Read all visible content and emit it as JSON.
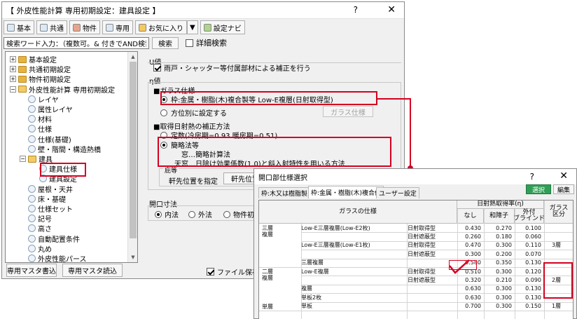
{
  "window": {
    "title": "【 外皮性能計算 専用初期設定：建具設定 】",
    "help": "?",
    "close": "✕"
  },
  "toolbar": [
    {
      "label": "基本",
      "icon": "gear-icon"
    },
    {
      "label": "共通",
      "icon": "gear-icon"
    },
    {
      "label": "物件",
      "icon": "house-icon"
    },
    {
      "label": "専用",
      "icon": "gear-icon"
    },
    {
      "label": "お気に入り",
      "icon": "star-folder-icon"
    },
    {
      "label": "▼",
      "icon": ""
    },
    {
      "label": "設定ナビ",
      "icon": "navi-icon"
    }
  ],
  "search": {
    "value": "検索ワード入力：（複数可。& 付きでAND検索文字）",
    "button": "検索",
    "detail_label": "詳細検索"
  },
  "tree": [
    {
      "label": "基本設定",
      "level": 0,
      "expander": "+",
      "icon": "folder"
    },
    {
      "label": "共通初期設定",
      "level": 0,
      "expander": "+",
      "icon": "folder"
    },
    {
      "label": "物件初期設定",
      "level": 0,
      "expander": "+",
      "icon": "folder"
    },
    {
      "label": "外皮性能計算 専用初期設定",
      "level": 0,
      "expander": "−",
      "icon": "folder-open"
    },
    {
      "label": "レイヤ",
      "level": 1,
      "expander": "",
      "icon": "page"
    },
    {
      "label": "属性レイヤ",
      "level": 1,
      "expander": "",
      "icon": "page"
    },
    {
      "label": "材料",
      "level": 1,
      "expander": "",
      "icon": "page"
    },
    {
      "label": "仕様",
      "level": 1,
      "expander": "",
      "icon": "page"
    },
    {
      "label": "仕様(基礎)",
      "level": 1,
      "expander": "",
      "icon": "page"
    },
    {
      "label": "壁・階間・構造熱橋",
      "level": 1,
      "expander": "",
      "icon": "page"
    },
    {
      "label": "建具",
      "level": 1,
      "expander": "−",
      "icon": "folder-open"
    },
    {
      "label": "建具仕様",
      "level": 2,
      "expander": "",
      "icon": "page"
    },
    {
      "label": "建具設定",
      "level": 2,
      "expander": "",
      "icon": "page"
    },
    {
      "label": "屋根・天井",
      "level": 1,
      "expander": "",
      "icon": "page"
    },
    {
      "label": "床・基礎",
      "level": 1,
      "expander": "",
      "icon": "page"
    },
    {
      "label": "仕様セット",
      "level": 1,
      "expander": "",
      "icon": "page"
    },
    {
      "label": "記号",
      "level": 1,
      "expander": "",
      "icon": "page"
    },
    {
      "label": "高さ",
      "level": 1,
      "expander": "",
      "icon": "page"
    },
    {
      "label": "自動配置条件",
      "level": 1,
      "expander": "",
      "icon": "page"
    },
    {
      "label": "丸め",
      "level": 1,
      "expander": "",
      "icon": "page"
    },
    {
      "label": "外皮性能パース",
      "level": 1,
      "expander": "",
      "icon": "page"
    }
  ],
  "bottom": {
    "write_btn": "専用マスタ書込",
    "read_btn": "専用マスタ読込",
    "save_file": "ファイル保存"
  },
  "panel": {
    "u_title": "U値",
    "u_check": "雨戸・シャッター等付属部材による補正を行う",
    "eta_title": "η値",
    "glass_title": "■ガラス仕様",
    "glass_opt1": "枠:金属・樹脂(木)複合製等 Low-E複層(日射取得型)",
    "glass_opt2": "方位別に設定する",
    "glass_btn": "ガラス仕様",
    "solar_title": "■取得日射熱の補正方法",
    "solar_opt1": "定数(冷房期=0.93 暖房期=0.51)",
    "solar_opt2": "簡略法等",
    "solar_line1": "窓…簡略計算法",
    "solar_line2": "天窓…日除け効果係数(1.0)と斜入射特性を用いる方法",
    "eave_title": "庇等",
    "eave_label": "軒先位置を指定",
    "eave_btn": "軒先位置",
    "dim_title": "開口寸法",
    "dim_opts": [
      "内法",
      "外法",
      "物件初期"
    ]
  },
  "dialog": {
    "title": "開口部仕様選択",
    "help": "?",
    "close": "✕",
    "tabs": [
      "枠:木又は樹脂製",
      "枠:金属・樹脂(木)複合他",
      "ユーザー設定"
    ],
    "select_btn": "選択",
    "edit_btn": "編集",
    "header_glass": "ガラスの仕様",
    "header_eta": "日射熱取得率(η)",
    "header_none": "なし",
    "header_shoji": "和障子",
    "header_blind": "外付\nブラインド",
    "header_kubun": "ガラス\n区分",
    "rows": [
      {
        "g1": "三層\n複層",
        "g2": "Low-E三層複層(Low-E2枚)",
        "g3": "日射取得型",
        "n": "0.430",
        "s": "0.270",
        "b": "0.100",
        "k": ""
      },
      {
        "g1": "",
        "g2": "",
        "g3": "日射遮蔽型",
        "n": "0.260",
        "s": "0.180",
        "b": "0.060",
        "k": ""
      },
      {
        "g1": "",
        "g2": "Low-E三層複層(Low-E1枚)",
        "g3": "日射取得型",
        "n": "0.470",
        "s": "0.300",
        "b": "0.110",
        "k": "3層"
      },
      {
        "g1": "",
        "g2": "",
        "g3": "日射遮蔽型",
        "n": "0.300",
        "s": "0.200",
        "b": "0.070",
        "k": ""
      },
      {
        "g1": "",
        "g2": "三層複層",
        "g3": "",
        "n": "0.580",
        "s": "0.350",
        "b": "0.130",
        "k": ""
      },
      {
        "g1": "二層\n複層",
        "g2": "Low-E複層",
        "g3": "日射取得型",
        "n": "0.510",
        "s": "0.300",
        "b": "0.120",
        "k": ""
      },
      {
        "g1": "",
        "g2": "",
        "g3": "日射遮蔽型",
        "n": "0.320",
        "s": "0.210",
        "b": "0.090",
        "k": "2層"
      },
      {
        "g1": "",
        "g2": "複層",
        "g3": "",
        "n": "0.630",
        "s": "0.300",
        "b": "0.130",
        "k": ""
      },
      {
        "g1": "",
        "g2": "単板2枚",
        "g3": "",
        "n": "0.630",
        "s": "0.300",
        "b": "0.130",
        "k": ""
      },
      {
        "g1": "単層",
        "g2": "単板",
        "g3": "",
        "n": "0.700",
        "s": "0.300",
        "b": "0.150",
        "k": "1層"
      }
    ]
  },
  "colors": {
    "accent_red": "#d40020",
    "select_green": "#2f9f55",
    "folder": "#e8b43f"
  }
}
